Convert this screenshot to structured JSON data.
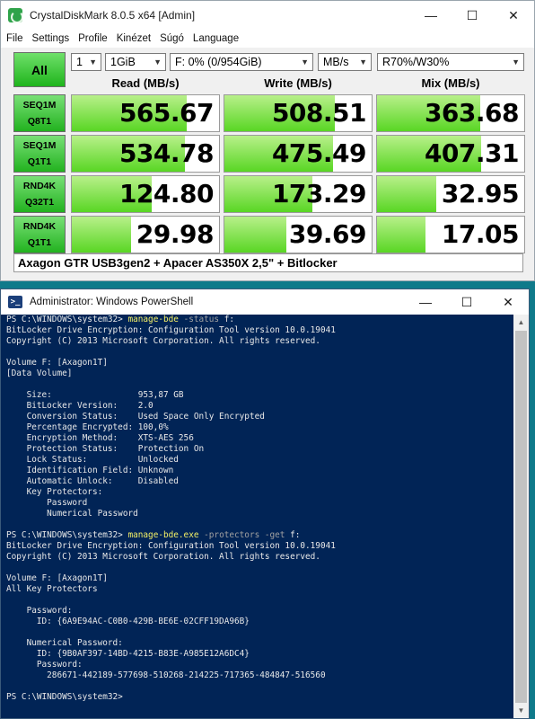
{
  "cdm": {
    "title": "CrystalDiskMark 8.0.5 x64 [Admin]",
    "window_buttons": [
      "—",
      "☐",
      "✕"
    ],
    "menu": [
      "File",
      "Settings",
      "Profile",
      "Kinézet",
      "Súgó",
      "Language"
    ],
    "all_label": "All",
    "count": "1",
    "size": "1GiB",
    "drive": "F: 0% (0/954GiB)",
    "unit": "MB/s",
    "profile": "R70%/W30%",
    "headers": {
      "read": "Read (MB/s)",
      "write": "Write (MB/s)",
      "mix": "Mix (MB/s)"
    },
    "rows": [
      {
        "l1": "SEQ1M",
        "l2": "Q8T1",
        "read": "565.67",
        "write": "508.51",
        "mix": "363.68",
        "rf": 0.78,
        "wf": 0.75,
        "mf": 0.7
      },
      {
        "l1": "SEQ1M",
        "l2": "Q1T1",
        "read": "534.78",
        "write": "475.49",
        "mix": "407.31",
        "rf": 0.77,
        "wf": 0.74,
        "mf": 0.71
      },
      {
        "l1": "RND4K",
        "l2": "Q32T1",
        "read": "124.80",
        "write": "173.29",
        "mix": "32.95",
        "rf": 0.54,
        "wf": 0.6,
        "mf": 0.4
      },
      {
        "l1": "RND4K",
        "l2": "Q1T1",
        "read": "29.98",
        "write": "39.69",
        "mix": "17.05",
        "rf": 0.4,
        "wf": 0.42,
        "mf": 0.33
      }
    ],
    "comment": "Axagon GTR USB3gen2 + Apacer AS350X 2,5\" + Bitlocker"
  },
  "ps": {
    "title": "Administrator: Windows PowerShell",
    "window_buttons": [
      "—",
      "☐",
      "✕"
    ],
    "lines": [
      [
        {
          "t": "PS C:\\WINDOWS\\system32> "
        },
        {
          "t": "manage-bde",
          "c": "cmd"
        },
        {
          "t": " -status",
          "c": "param"
        },
        {
          "t": " f:"
        }
      ],
      [
        {
          "t": "BitLocker Drive Encryption: Configuration Tool version 10.0.19041"
        }
      ],
      [
        {
          "t": "Copyright (C) 2013 Microsoft Corporation. All rights reserved."
        }
      ],
      [
        {
          "t": ""
        }
      ],
      [
        {
          "t": "Volume F: [Axagon1T]"
        }
      ],
      [
        {
          "t": "[Data Volume]"
        }
      ],
      [
        {
          "t": ""
        }
      ],
      [
        {
          "t": "    Size:                 953,87 GB"
        }
      ],
      [
        {
          "t": "    BitLocker Version:    2.0"
        }
      ],
      [
        {
          "t": "    Conversion Status:    Used Space Only Encrypted"
        }
      ],
      [
        {
          "t": "    Percentage Encrypted: 100,0%"
        }
      ],
      [
        {
          "t": "    Encryption Method:    XTS-AES 256"
        }
      ],
      [
        {
          "t": "    Protection Status:    Protection On"
        }
      ],
      [
        {
          "t": "    Lock Status:          Unlocked"
        }
      ],
      [
        {
          "t": "    Identification Field: Unknown"
        }
      ],
      [
        {
          "t": "    Automatic Unlock:     Disabled"
        }
      ],
      [
        {
          "t": "    Key Protectors:"
        }
      ],
      [
        {
          "t": "        Password"
        }
      ],
      [
        {
          "t": "        Numerical Password"
        }
      ],
      [
        {
          "t": ""
        }
      ],
      [
        {
          "t": "PS C:\\WINDOWS\\system32> "
        },
        {
          "t": "manage-bde.exe",
          "c": "cmd"
        },
        {
          "t": " -protectors -get",
          "c": "param"
        },
        {
          "t": " f:"
        }
      ],
      [
        {
          "t": "BitLocker Drive Encryption: Configuration Tool version 10.0.19041"
        }
      ],
      [
        {
          "t": "Copyright (C) 2013 Microsoft Corporation. All rights reserved."
        }
      ],
      [
        {
          "t": ""
        }
      ],
      [
        {
          "t": "Volume F: [Axagon1T]"
        }
      ],
      [
        {
          "t": "All Key Protectors"
        }
      ],
      [
        {
          "t": ""
        }
      ],
      [
        {
          "t": "    Password:"
        }
      ],
      [
        {
          "t": "      ID: {6A9E94AC-C0B0-429B-BE6E-02CFF19DA96B}"
        }
      ],
      [
        {
          "t": ""
        }
      ],
      [
        {
          "t": "    Numerical Password:"
        }
      ],
      [
        {
          "t": "      ID: {9B0AF397-14BD-4215-B83E-A985E12A6DC4}"
        }
      ],
      [
        {
          "t": "      Password:"
        }
      ],
      [
        {
          "t": "        286671-442189-577698-510268-214225-717365-484847-516560"
        }
      ],
      [
        {
          "t": ""
        }
      ],
      [
        {
          "t": "PS C:\\WINDOWS\\system32>"
        }
      ]
    ]
  }
}
